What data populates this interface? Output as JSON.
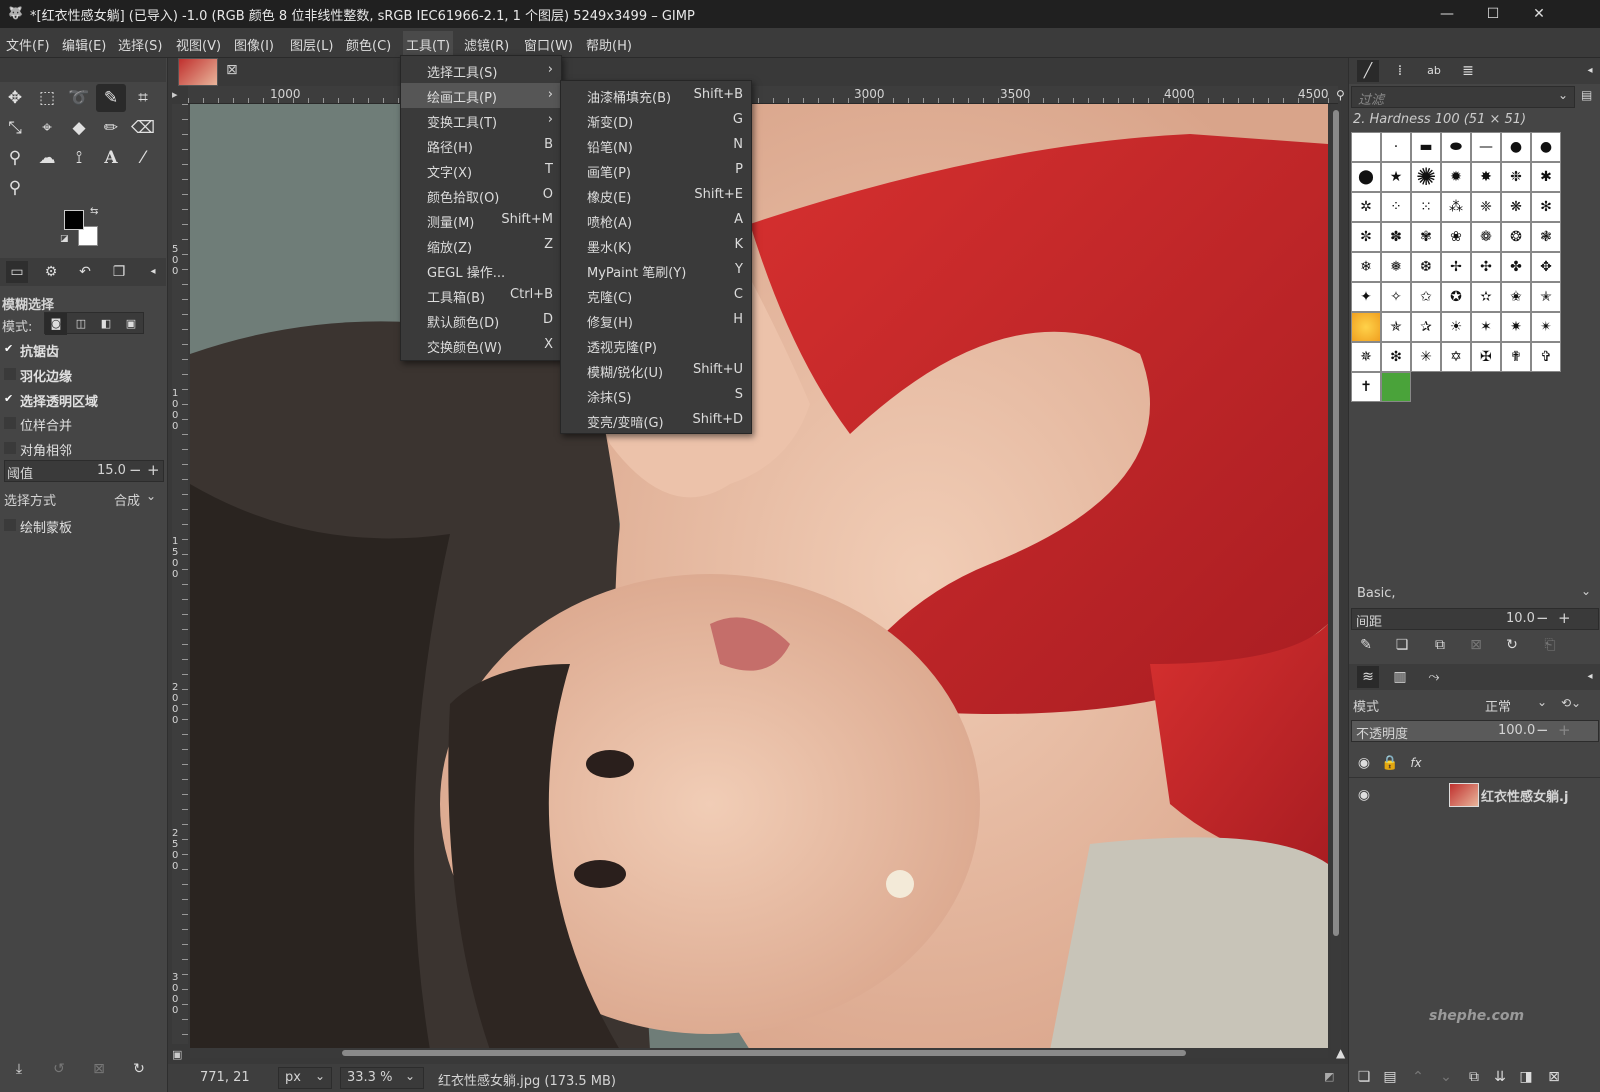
{
  "window": {
    "title": "*[红衣性感女躺] (已导入) -1.0 (RGB 颜色 8 位非线性整数, sRGB IEC61966-2.1, 1 个图层) 5249x3499 – GIMP",
    "minimize": "—",
    "maximize": "☐",
    "close": "✕"
  },
  "menubar": [
    "文件(F)",
    "编辑(E)",
    "选择(S)",
    "视图(V)",
    "图像(I)",
    "图层(L)",
    "颜色(C)",
    "工具(T)",
    "滤镜(R)",
    "窗口(W)",
    "帮助(H)"
  ],
  "tools_menu": [
    {
      "label": "选择工具(S)",
      "shortcut": "",
      "submenu": true
    },
    {
      "label": "绘画工具(P)",
      "shortcut": "",
      "submenu": true
    },
    {
      "label": "变换工具(T)",
      "shortcut": "",
      "submenu": true
    },
    {
      "label": "路径(H)",
      "shortcut": "B"
    },
    {
      "label": "文字(X)",
      "shortcut": "T"
    },
    {
      "label": "颜色拾取(O)",
      "shortcut": "O"
    },
    {
      "label": "测量(M)",
      "shortcut": "Shift+M"
    },
    {
      "label": "缩放(Z)",
      "shortcut": "Z"
    },
    {
      "label": "GEGL 操作...",
      "shortcut": ""
    },
    {
      "label": "工具箱(B)",
      "shortcut": "Ctrl+B"
    },
    {
      "label": "默认颜色(D)",
      "shortcut": "D"
    },
    {
      "label": "交换颜色(W)",
      "shortcut": "X"
    }
  ],
  "paint_menu": [
    {
      "label": "油漆桶填充(B)",
      "shortcut": "Shift+B"
    },
    {
      "label": "渐变(D)",
      "shortcut": "G"
    },
    {
      "label": "铅笔(N)",
      "shortcut": "N"
    },
    {
      "label": "画笔(P)",
      "shortcut": "P"
    },
    {
      "label": "橡皮(E)",
      "shortcut": "Shift+E"
    },
    {
      "label": "喷枪(A)",
      "shortcut": "A"
    },
    {
      "label": "墨水(K)",
      "shortcut": "K"
    },
    {
      "label": "MyPaint 笔刷(Y)",
      "shortcut": "Y"
    },
    {
      "label": "克隆(C)",
      "shortcut": "C"
    },
    {
      "label": "修复(H)",
      "shortcut": "H"
    },
    {
      "label": "透视克隆(P)",
      "shortcut": ""
    },
    {
      "label": "模糊/锐化(U)",
      "shortcut": "Shift+U"
    },
    {
      "label": "涂抹(S)",
      "shortcut": "S"
    },
    {
      "label": "变亮/变暗(G)",
      "shortcut": "Shift+D"
    }
  ],
  "tool_options": {
    "title": "模糊选择",
    "mode_label": "模式:",
    "antialias": "抗锯齿",
    "feather": "羽化边缘",
    "select_transparent": "选择透明区域",
    "sample_merged": "位样合并",
    "diagonal": "对角相邻",
    "threshold_label": "阈值",
    "threshold_value": "15.0",
    "select_by_label": "选择方式",
    "select_by_value": "合成",
    "draw_mask": "绘制蒙板"
  },
  "ruler_top": [
    "1000",
    "3000",
    "3500",
    "4000",
    "4500"
  ],
  "ruler_left": [
    "500",
    "1000",
    "1500",
    "2000",
    "2500",
    "3000"
  ],
  "statusbar": {
    "coords": "771, 21",
    "unit": "px",
    "zoom": "33.3 %",
    "file": "红衣性感女躺.jpg (173.5 MB)"
  },
  "brushes": {
    "filter_placeholder": "过滤",
    "current": "2. Hardness 100 (51 × 51)",
    "preset": "Basic,",
    "spacing_label": "间距",
    "spacing_value": "10.0"
  },
  "layers": {
    "mode_label": "模式",
    "mode_value": "正常",
    "opacity_label": "不透明度",
    "opacity_value": "100.0",
    "layer_name": "红衣性感女躺.j"
  },
  "watermark": "shephe.com",
  "colors": {
    "accent": "#565656",
    "menu_bg": "#3a3a3a",
    "dress": "#c8282a",
    "skin": "#e8b8a0"
  }
}
